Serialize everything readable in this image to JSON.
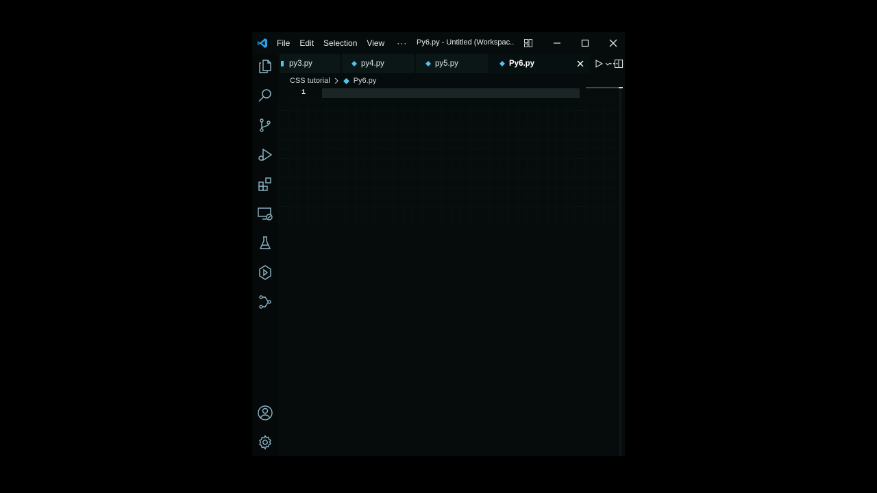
{
  "menu": {
    "file": "File",
    "edit": "Edit",
    "selection": "Selection",
    "view": "View",
    "more": "···"
  },
  "window_title": "Py6.py - Untitled (Workspac...",
  "tabs": [
    {
      "label": "py3.py",
      "active": false
    },
    {
      "label": "py4.py",
      "active": false
    },
    {
      "label": "py5.py",
      "active": false
    },
    {
      "label": "Py6.py",
      "active": true
    }
  ],
  "breadcrumb": {
    "folder": "CSS tutorial",
    "file": "Py6.py"
  },
  "editor": {
    "line_numbers": [
      "1"
    ]
  },
  "activity_icons": [
    "explorer-icon",
    "search-icon",
    "source-control-icon",
    "run-debug-icon",
    "extensions-icon",
    "remote-explorer-icon",
    "testing-icon",
    "copilot-icon",
    "git-graph-icon",
    "account-icon",
    "settings-gear-icon"
  ],
  "colors": {
    "accent": "#4fc3f7",
    "background": "#060b0b",
    "activity_icon": "#8fb8c8"
  }
}
